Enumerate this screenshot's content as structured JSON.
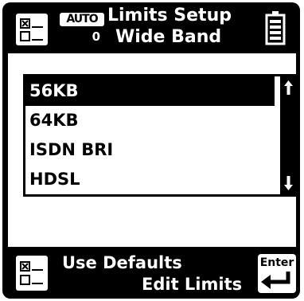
{
  "header": {
    "auto_label": "AUTO",
    "auto_value": "0",
    "title_line1": "Limits Setup",
    "title_line2": "Wide Band"
  },
  "list": {
    "items": [
      {
        "label": "56KB",
        "selected": true
      },
      {
        "label": "64KB",
        "selected": false
      },
      {
        "label": "ISDN BRI",
        "selected": false
      },
      {
        "label": "HDSL",
        "selected": false
      }
    ],
    "scroll_up_icon": "arrow-up-icon",
    "scroll_down_icon": "arrow-down-icon"
  },
  "footer": {
    "use_defaults_label": "Use Defaults",
    "edit_limits_label": "Edit Limits",
    "enter_label": "Enter"
  },
  "colors": {
    "background": "#000000",
    "foreground": "#ffffff"
  }
}
